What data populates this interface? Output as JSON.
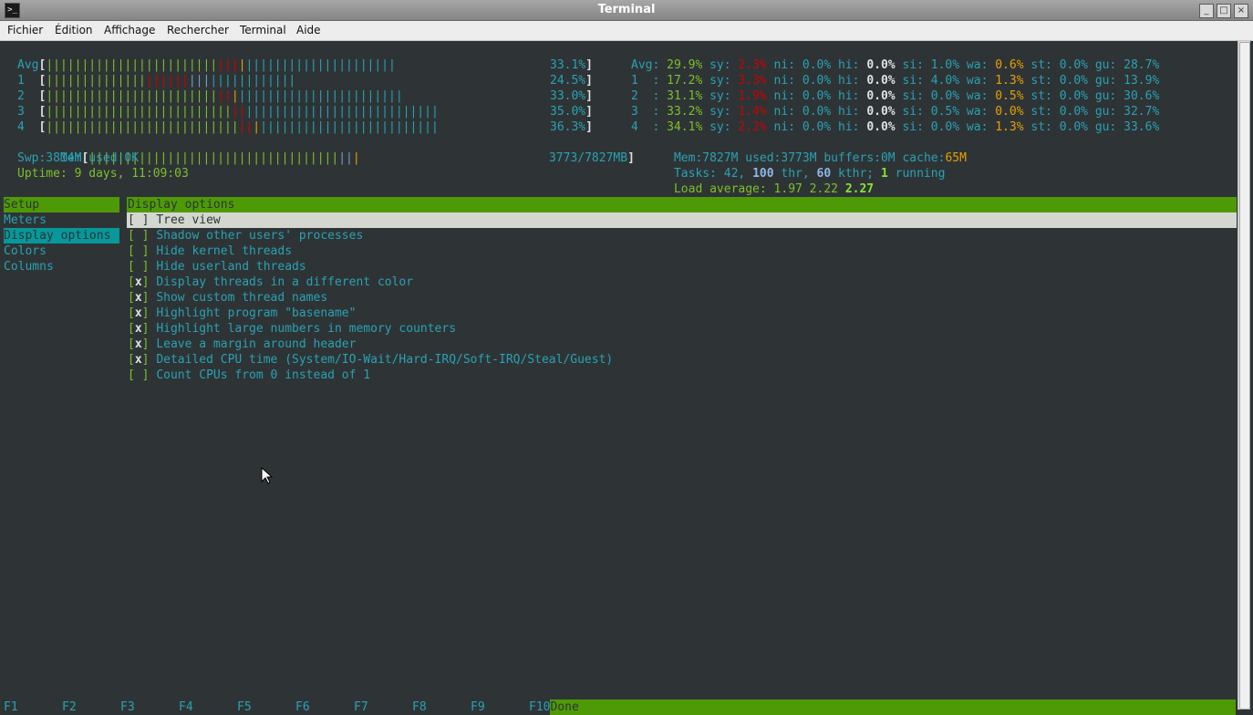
{
  "window": {
    "title": "Terminal",
    "icon": "terminal-icon"
  },
  "menu": [
    "Fichier",
    "Édition",
    "Affichage",
    "Rechercher",
    "Terminal",
    "Aide"
  ],
  "meters": {
    "cpu_bars": [
      {
        "label": "Avg",
        "pct": "33.1%"
      },
      {
        "label": "1  ",
        "pct": "24.5%"
      },
      {
        "label": "2  ",
        "pct": "33.0%"
      },
      {
        "label": "3  ",
        "pct": "35.0%"
      },
      {
        "label": "4  ",
        "pct": "36.3%"
      }
    ],
    "mem_label": "Mem",
    "mem_value": "3773/7827MB",
    "swp": "Swp:3814M used:0K",
    "uptime": "Uptime: 9 days, 11:09:03",
    "cpu_detail": [
      {
        "label": "Avg:",
        "usr": "29.9%",
        "sy": "2.3%",
        "ni": "0.0%",
        "hi": "0.0%",
        "si": "1.0%",
        "wa": "0.6%",
        "st": "0.0%",
        "gu": "28.7%"
      },
      {
        "label": "1  :",
        "usr": "17.2%",
        "sy": "3.3%",
        "ni": "0.0%",
        "hi": "0.0%",
        "si": "4.0%",
        "wa": "1.3%",
        "st": "0.0%",
        "gu": "13.9%"
      },
      {
        "label": "2  :",
        "usr": "31.1%",
        "sy": "1.9%",
        "ni": "0.0%",
        "hi": "0.0%",
        "si": "0.0%",
        "wa": "0.5%",
        "st": "0.0%",
        "gu": "30.6%"
      },
      {
        "label": "3  :",
        "usr": "33.2%",
        "sy": "1.4%",
        "ni": "0.0%",
        "hi": "0.0%",
        "si": "0.5%",
        "wa": "0.0%",
        "st": "0.0%",
        "gu": "32.7%"
      },
      {
        "label": "4  :",
        "usr": "34.1%",
        "sy": "2.2%",
        "ni": "0.0%",
        "hi": "0.0%",
        "si": "0.0%",
        "wa": "1.3%",
        "st": "0.0%",
        "gu": "33.6%"
      }
    ],
    "mem_detail": {
      "total": "Mem:7827M",
      "used": "used:3773M",
      "buffers": "buffers:0M",
      "cache_label": "cache:",
      "cache": "65M"
    },
    "tasks": {
      "prefix": "Tasks: 42, ",
      "thr": "100",
      "thr_label": " thr, ",
      "kthr": "60",
      "kthr_label": " kthr; ",
      "running": "1",
      "running_label": " running"
    },
    "load": {
      "prefix": "Load average: 1.97 2.22 ",
      "last": "2.27"
    }
  },
  "setup": {
    "categories_header": "Setup",
    "categories": [
      "Meters",
      "Display options",
      "Colors",
      "Columns"
    ],
    "selected_category": "Display options",
    "panel_header": "Display options",
    "options": [
      {
        "checked": false,
        "label": "Tree view"
      },
      {
        "checked": false,
        "label": "Shadow other users' processes"
      },
      {
        "checked": false,
        "label": "Hide kernel threads"
      },
      {
        "checked": false,
        "label": "Hide userland threads"
      },
      {
        "checked": true,
        "label": "Display threads in a different color"
      },
      {
        "checked": true,
        "label": "Show custom thread names"
      },
      {
        "checked": true,
        "label": "Highlight program \"basename\""
      },
      {
        "checked": true,
        "label": "Highlight large numbers in memory counters"
      },
      {
        "checked": true,
        "label": "Leave a margin around header"
      },
      {
        "checked": true,
        "label": "Detailed CPU time (System/IO-Wait/Hard-IRQ/Soft-IRQ/Steal/Guest)"
      },
      {
        "checked": false,
        "label": "Count CPUs from 0 instead of 1"
      }
    ]
  },
  "fkeys": [
    "F1",
    "F2",
    "F3",
    "F4",
    "F5",
    "F6",
    "F7",
    "F8",
    "F9",
    "F10"
  ],
  "fkey_done": "Done",
  "colors": {
    "green": "#4e9a06",
    "cyan": "#06989a",
    "text": "#2aa1b3",
    "red": "#cc0000",
    "bg": "#2e3436"
  }
}
